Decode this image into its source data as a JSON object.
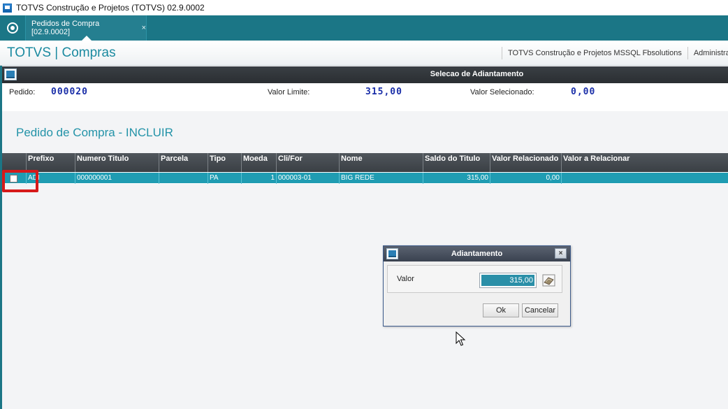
{
  "window": {
    "title": "TOTVS Construção e Projetos (TOTVS) 02.9.0002"
  },
  "tabbar": {
    "tab_label": "Pedidos de Compra [02.9.0002]",
    "tab_close": "×"
  },
  "header": {
    "brand": "TOTVS | Compras",
    "company": "TOTVS Construção e Projetos MSSQL Fbsolutions",
    "user": "Administrad"
  },
  "selection": {
    "title": "Selecao de Adiantamento",
    "pedido_label": "Pedido:",
    "pedido_value": "000020",
    "limite_label": "Valor Limite:",
    "limite_value": "315,00",
    "selecionado_label": "Valor Selecionado:",
    "selecionado_value": "0,00"
  },
  "form": {
    "title": "Pedido de Compra - INCLUIR"
  },
  "grid": {
    "columns": [
      "",
      "Prefixo",
      "Numero Titulo",
      "Parcela",
      "Tipo",
      "Moeda",
      "Cli/For",
      "Nome",
      "Saldo do Titulo",
      "Valor Relacionado",
      "Valor a Relacionar"
    ],
    "rows": [
      [
        "",
        "ADI",
        "000000001",
        "",
        "PA",
        "1",
        "000003-01",
        "BIG REDE",
        "315,00",
        "0,00",
        ""
      ]
    ]
  },
  "dialog": {
    "title": "Adiantamento",
    "close": "×",
    "field_label": "Valor",
    "field_value": "315,00",
    "ok_label": "Ok",
    "cancel_label": "Cancelar"
  },
  "colors": {
    "teal_bar": "#1b7686",
    "row_selected": "#1f9cb2",
    "brand_text": "#1b8aa0",
    "highlight_red": "#d61a1a",
    "value_blue": "#1a2ea8"
  }
}
